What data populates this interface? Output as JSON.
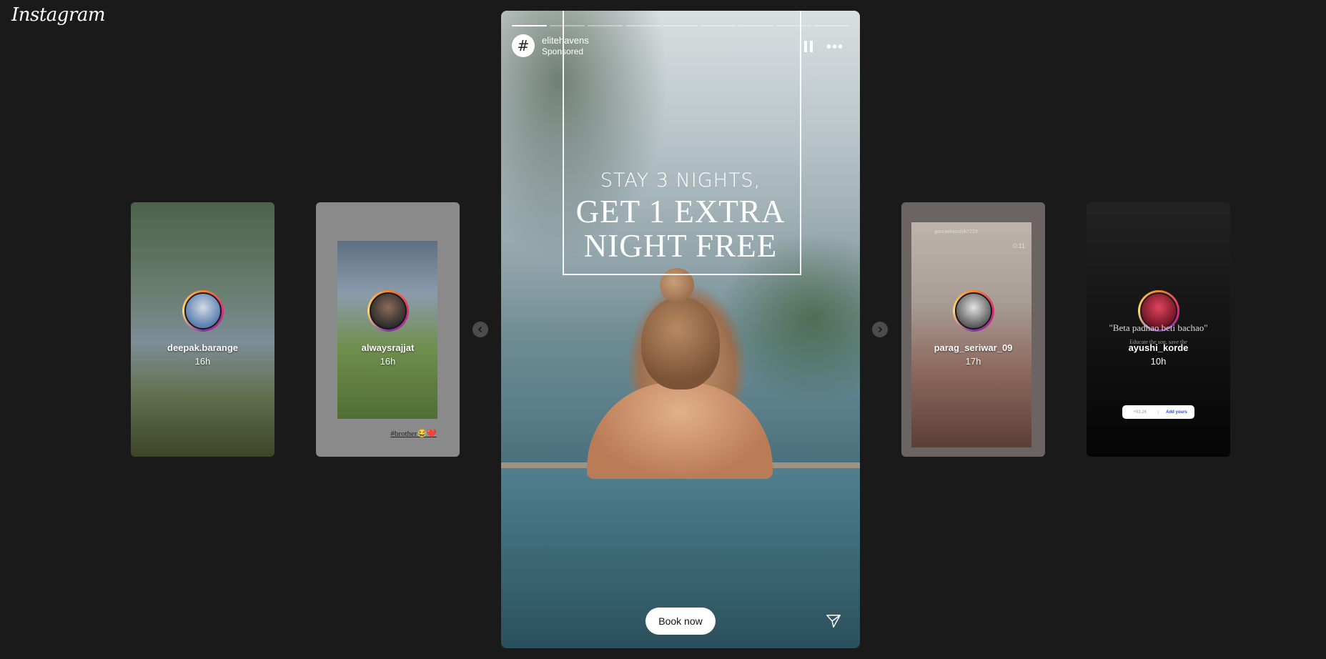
{
  "app": {
    "logo": "Instagram"
  },
  "stories_left": [
    {
      "username": "deepak.barange",
      "time": "16h"
    },
    {
      "username": "alwaysrajjat",
      "time": "16h",
      "caption": "#brother😂❤️"
    }
  ],
  "stories_right": [
    {
      "username": "parag_seriwar_09",
      "time": "17h",
      "inner_user": "gauravkaushik7229",
      "inner_timer": "0:11"
    },
    {
      "username": "ayushi_korde",
      "time": "10h",
      "quote": "\"Beta padhao beti bachao\"",
      "sub_quote": "Educate the son, save the",
      "sticker_count": "+93.2K",
      "sticker_label": "Add yours"
    }
  ],
  "active_story": {
    "username": "elitehavens",
    "subtitle": "Sponsored",
    "avatar_glyph": "#",
    "segments": 9,
    "active_segment": 1,
    "promo_line1": "STAY 3 NIGHTS,",
    "promo_line2": "GET 1 EXTRA",
    "promo_line3": "NIGHT FREE",
    "cta_label": "Book now"
  },
  "icons": {
    "pause": "pause-icon",
    "more": "more-options-icon",
    "send": "send-icon",
    "prev": "chevron-left-icon",
    "next": "chevron-right-icon"
  }
}
